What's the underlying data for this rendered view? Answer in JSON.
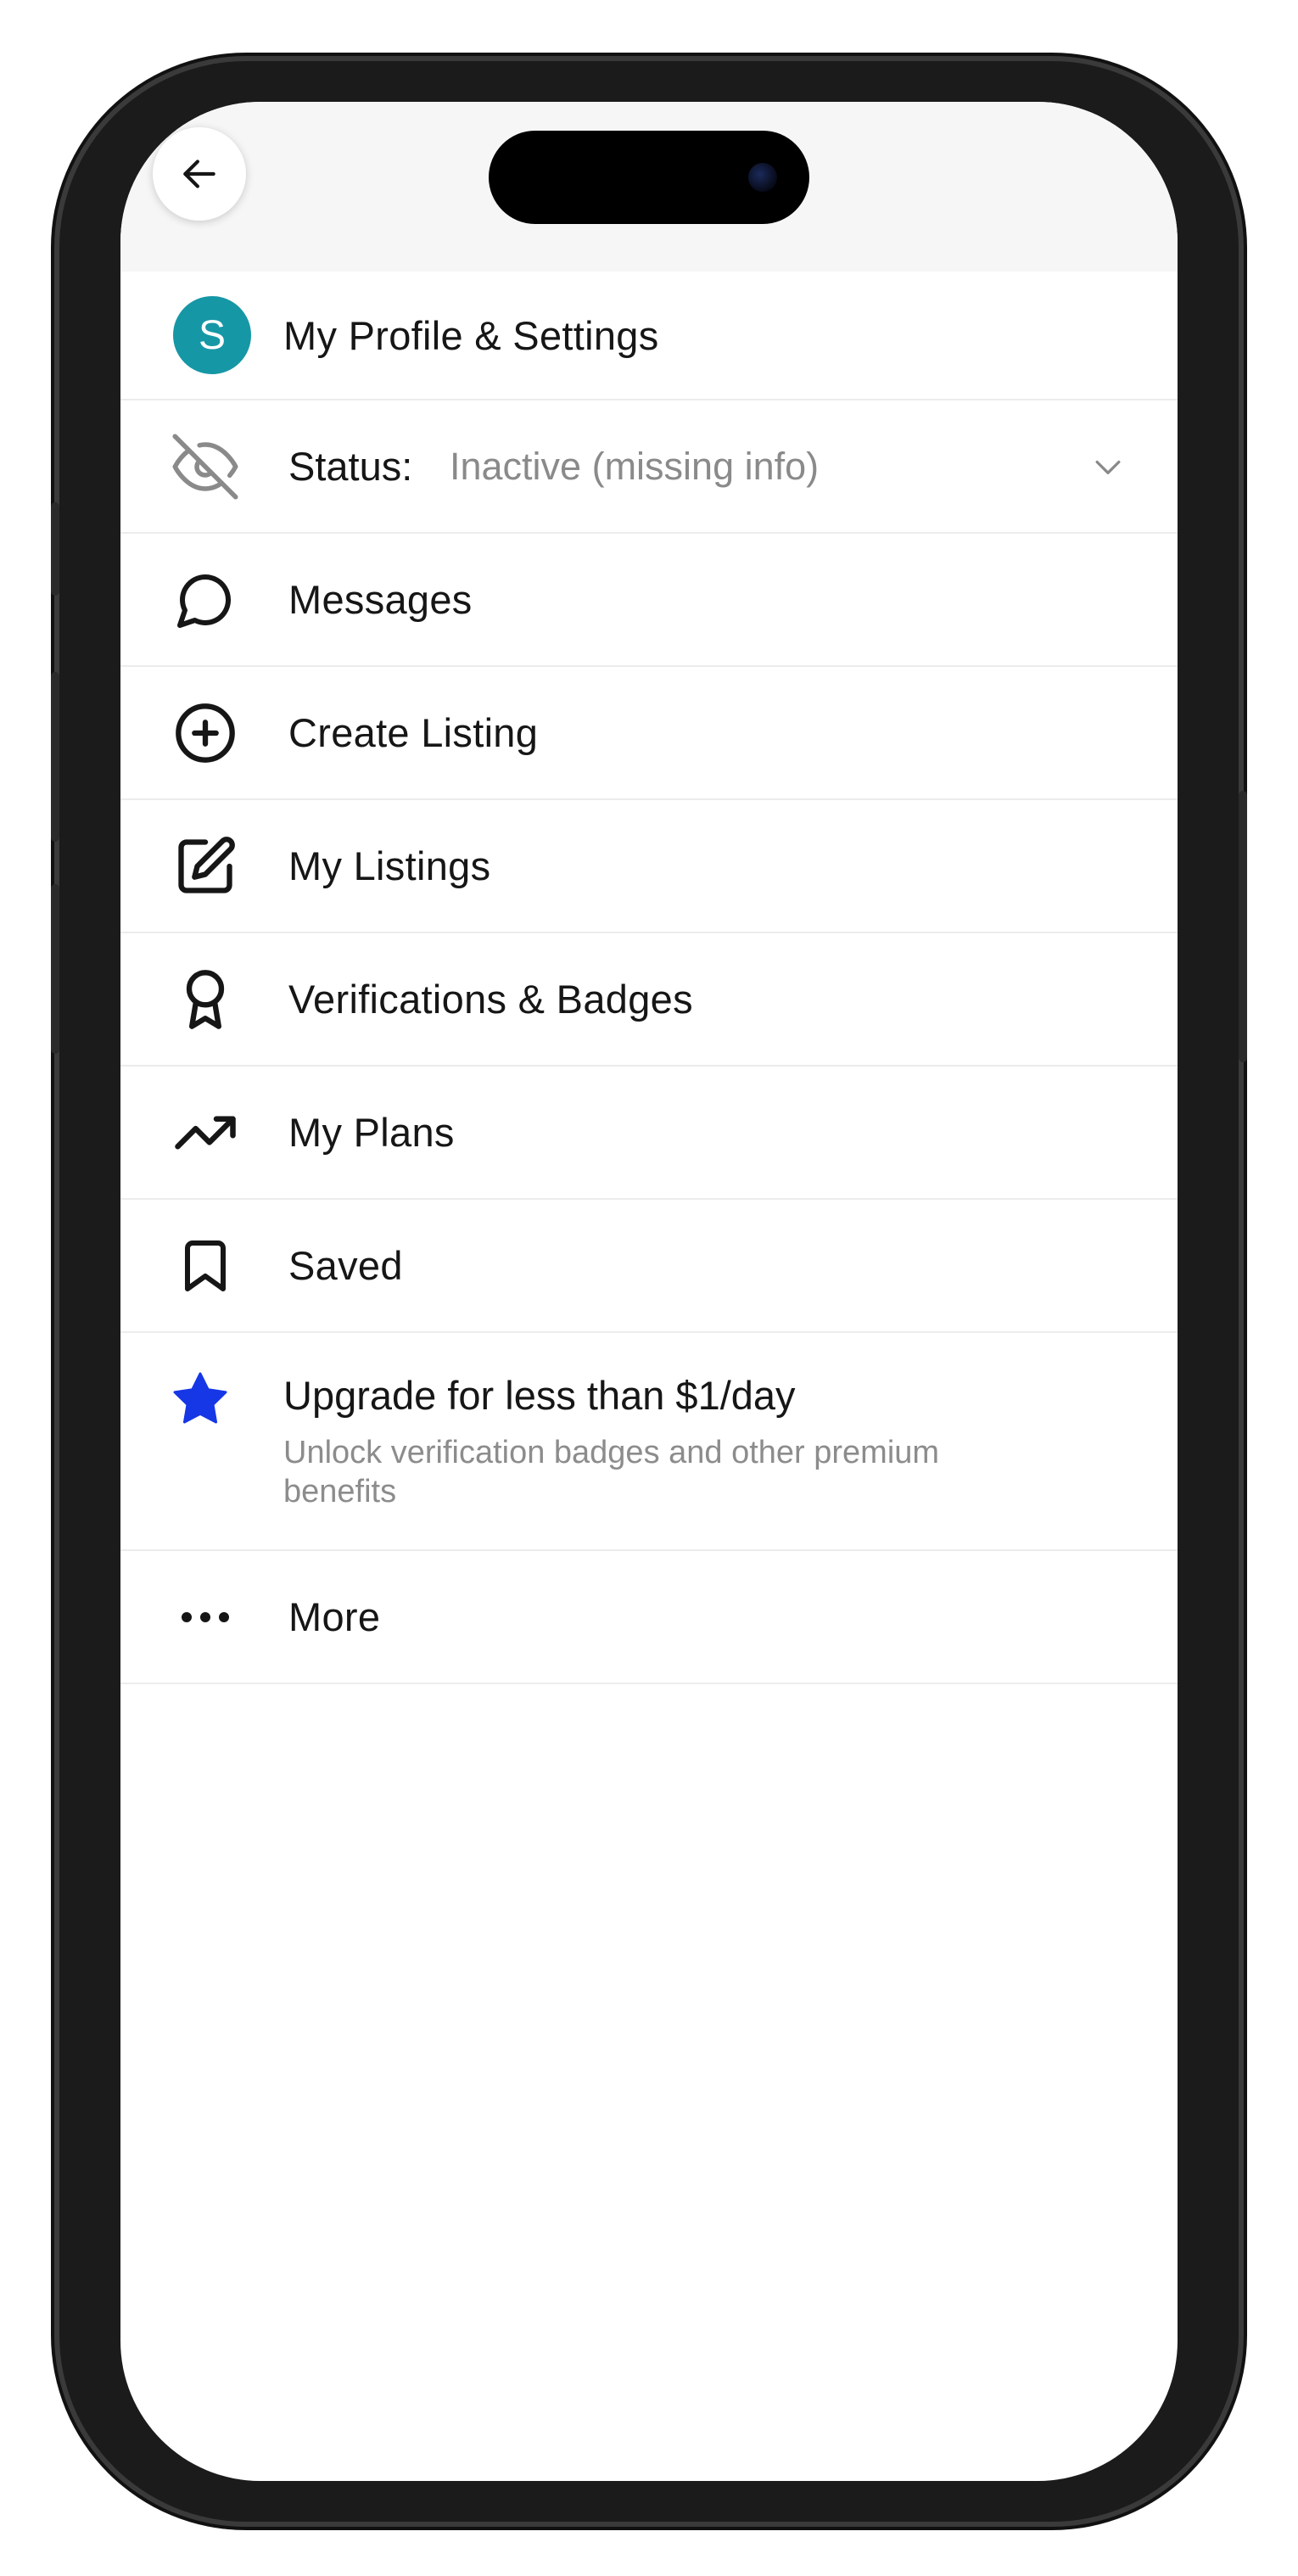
{
  "menu": {
    "profile": {
      "avatar_initial": "S",
      "label": "My Profile & Settings"
    },
    "status": {
      "label": "Status:",
      "value": "Inactive (missing info)"
    },
    "messages": "Messages",
    "create_listing": "Create Listing",
    "my_listings": "My Listings",
    "verifications": "Verifications & Badges",
    "my_plans": "My Plans",
    "saved": "Saved",
    "upgrade": {
      "title": "Upgrade for less than $1/day",
      "subtitle": "Unlock verification badges and other premium benefits"
    },
    "more": "More"
  },
  "colors": {
    "avatar": "#1697a6",
    "star": "#1637e6",
    "icon": "#161616",
    "muted": "#8a8a8a"
  },
  "icons": {
    "back": "arrow-left-icon",
    "status": "eye-off-icon",
    "messages": "chat-bubble-icon",
    "create_listing": "plus-circle-icon",
    "my_listings": "edit-square-icon",
    "verifications": "award-ribbon-icon",
    "my_plans": "trending-up-icon",
    "saved": "bookmark-icon",
    "upgrade": "star-icon",
    "more": "more-horizontal-icon"
  }
}
